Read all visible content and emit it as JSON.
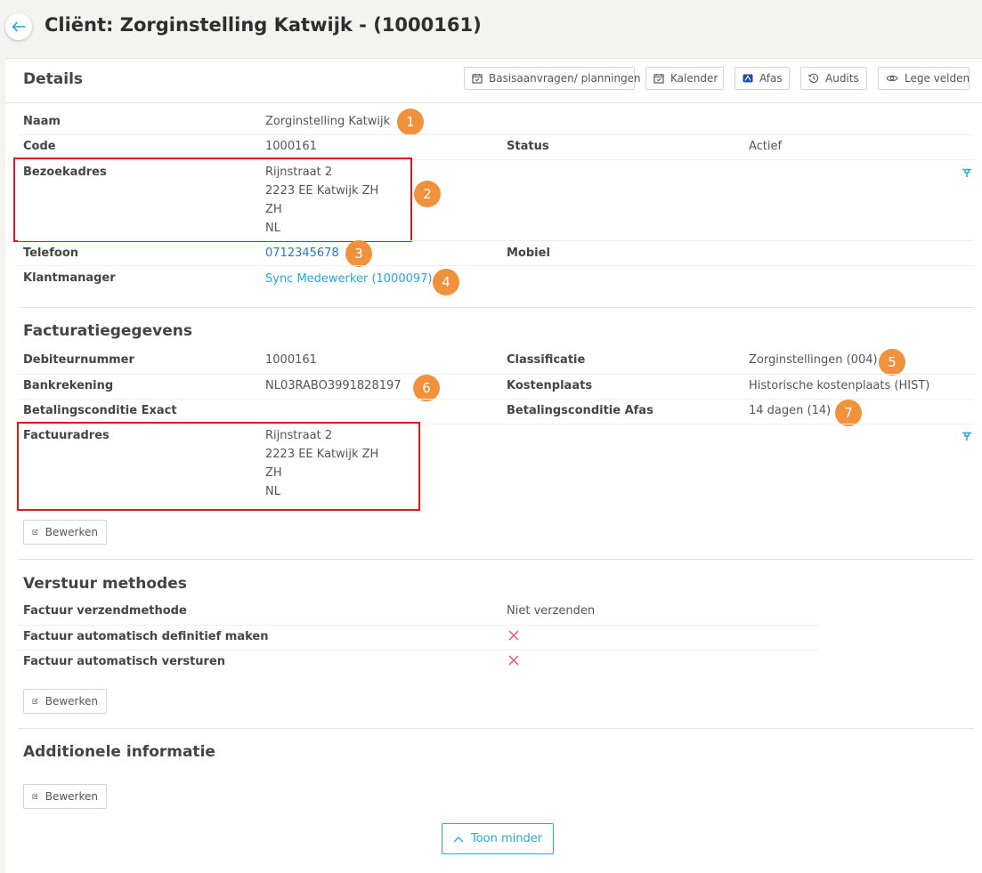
{
  "header": {
    "title": "Cliënt: Zorginstelling Katwijk - (1000161)"
  },
  "toolbar": {
    "basis_label": "Basisaanvragen/ planningen",
    "kalender_label": "Kalender",
    "afas_label": "Afas",
    "audits_label": "Audits",
    "lege_velden_label": "Lege velden"
  },
  "details": {
    "title": "Details",
    "naam_label": "Naam",
    "naam_value": "Zorginstelling Katwijk",
    "code_label": "Code",
    "code_value": "1000161",
    "status_label": "Status",
    "status_value": "Actief",
    "bezoekadres_label": "Bezoekadres",
    "bezoekadres_lines": [
      "Rijnstraat 2",
      "2223 EE Katwijk ZH",
      "ZH",
      "NL"
    ],
    "telefoon_label": "Telefoon",
    "telefoon_value": "0712345678",
    "mobiel_label": "Mobiel",
    "klantmanager_label": "Klantmanager",
    "klantmanager_value": "Sync Medewerker (1000097)"
  },
  "facturatie": {
    "title": "Facturatiegegevens",
    "debiteurnummer_label": "Debiteurnummer",
    "debiteurnummer_value": "1000161",
    "classificatie_label": "Classificatie",
    "classificatie_value": "Zorginstellingen (004)",
    "bankrekening_label": "Bankrekening",
    "bankrekening_value": "NL03RABO3991828197",
    "kostenplaats_label": "Kostenplaats",
    "kostenplaats_value": "Historische kostenplaats (HIST)",
    "betalingsconditie_exact_label": "Betalingsconditie Exact",
    "betalingsconditie_afas_label": "Betalingsconditie Afas",
    "betalingsconditie_afas_value": "14 dagen (14)",
    "factuuradres_label": "Factuuradres",
    "factuuradres_lines": [
      "Rijnstraat 2",
      "2223 EE Katwijk ZH",
      "ZH",
      "NL"
    ],
    "edit_label": "Bewerken"
  },
  "verstuur": {
    "title": "Verstuur methodes",
    "verzendmethode_label": "Factuur verzendmethode",
    "verzendmethode_value": "Niet verzenden",
    "definitief_label": "Factuur automatisch definitief maken",
    "versturen_label": "Factuur automatisch versturen",
    "edit_label": "Bewerken"
  },
  "additioneel": {
    "title": "Additionele informatie",
    "edit_label": "Bewerken"
  },
  "toon_minder_label": "Toon minder",
  "badges": [
    "1",
    "2",
    "3",
    "4",
    "5",
    "6",
    "7"
  ],
  "colors": {
    "badge": "#f0913b",
    "highlight_box": "#e01919",
    "link": "#2979c5",
    "accent": "#27a7de",
    "cross": "#e8505b"
  },
  "icons": [
    "arrow-left-icon",
    "calendar-icon",
    "afas-icon",
    "history-icon",
    "eye-icon",
    "pin-icon",
    "edit-icon",
    "close-icon",
    "chevron-up-icon"
  ]
}
